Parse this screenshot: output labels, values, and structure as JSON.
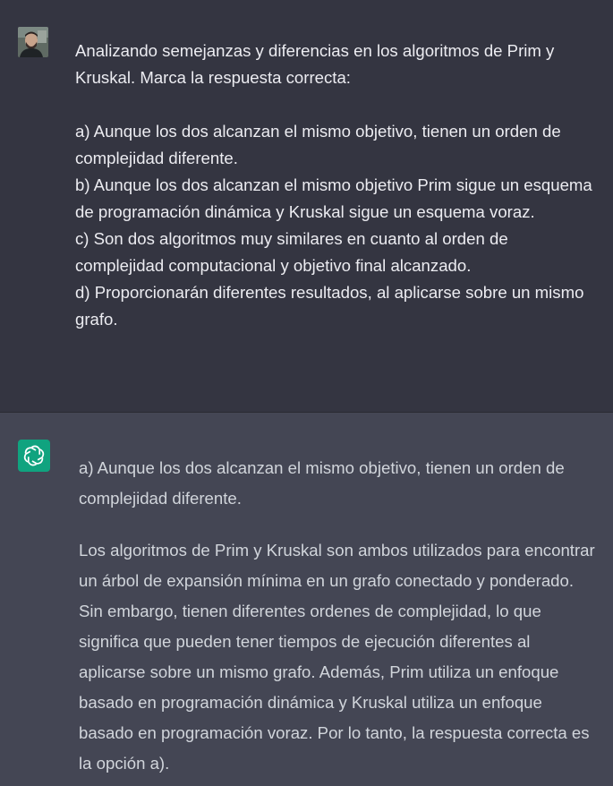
{
  "conversation": {
    "user_message": {
      "avatar": "user-photo-avatar",
      "text": "Analizando semejanzas y diferencias en los algoritmos de Prim y Kruskal. Marca la respuesta correcta:\n\na) Aunque los dos alcanzan el mismo objetivo, tienen un orden de complejidad diferente.\nb) Aunque los dos alcanzan el mismo objetivo Prim sigue un esquema de programación dinámica y Kruskal sigue un esquema voraz.\nc) Son dos algoritmos muy similares en cuanto al orden de complejidad computacional y objetivo final alcanzado.\nd) Proporcionarán diferentes resultados, al aplicarse sobre un mismo grafo."
    },
    "assistant_message": {
      "avatar": "openai-logo-icon",
      "paragraphs": [
        "a) Aunque los dos alcanzan el mismo objetivo, tienen un orden de complejidad diferente.",
        "Los algoritmos de Prim y Kruskal son ambos utilizados para encontrar un árbol de expansión mínima en un grafo conectado y ponderado. Sin embargo, tienen diferentes ordenes de complejidad, lo que significa que pueden tener tiempos de ejecución diferentes al aplicarse sobre un mismo grafo. Además, Prim utiliza un enfoque basado en programación dinámica y Kruskal utiliza un enfoque basado en programación voraz. Por lo tanto, la respuesta correcta es la opción a)."
      ]
    }
  },
  "colors": {
    "user_bg": "#343541",
    "assistant_bg": "#444654",
    "user_text": "#ececf1",
    "assistant_text": "#d1d5db",
    "logo_bg": "#10a37f"
  }
}
